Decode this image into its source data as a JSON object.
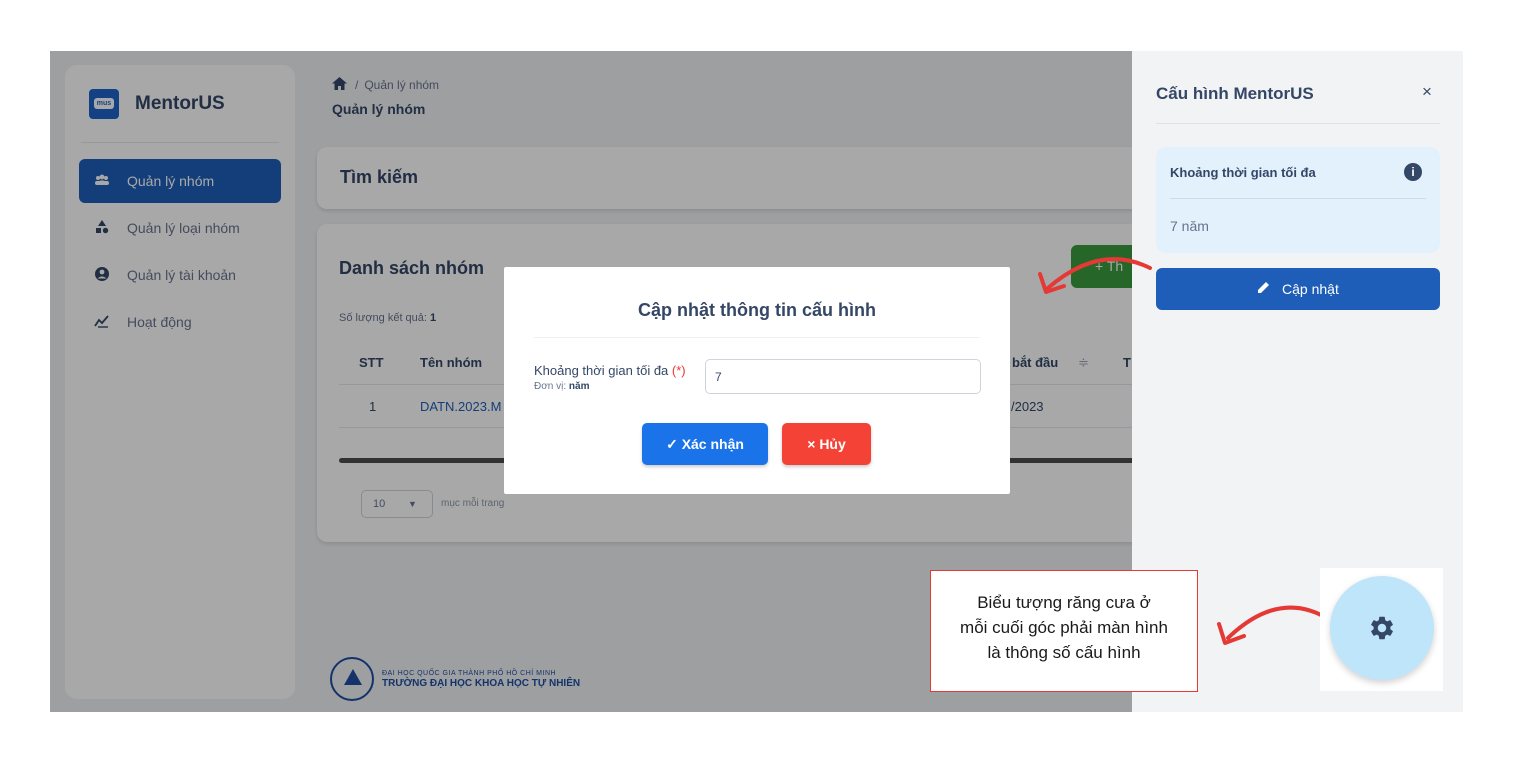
{
  "app": {
    "name": "MentorUS",
    "logo_text": "mus"
  },
  "sidebar": {
    "items": [
      {
        "label": "Quản lý nhóm",
        "icon": "users-icon",
        "active": true
      },
      {
        "label": "Quản lý loại nhóm",
        "icon": "shapes-icon",
        "active": false
      },
      {
        "label": "Quản lý tài khoản",
        "icon": "user-circle-icon",
        "active": false
      },
      {
        "label": "Hoạt động",
        "icon": "activity-chart-icon",
        "active": false
      }
    ]
  },
  "header": {
    "breadcrumb": "Quản lý nhóm",
    "title": "Quản lý nhóm"
  },
  "search": {
    "title": "Tìm kiếm"
  },
  "group_list": {
    "title": "Danh sách nhóm",
    "add_label": "+ Th",
    "result_label": "Số lượng kết quả:",
    "result_count": "1",
    "columns": {
      "stt": "STT",
      "name": "Tên nhóm",
      "start": "bắt đầu",
      "sort_icon": "≑",
      "next": "T"
    },
    "rows": [
      {
        "stt": "1",
        "name": "DATN.2023.M",
        "start": "/2023"
      }
    ],
    "page_size": "10",
    "per_page_label": "mục mỗi trang"
  },
  "footer": {
    "university_line1": "ĐẠI HỌC QUỐC GIA THÀNH PHỐ HỒ CHÍ MINH",
    "university_line2": "TRƯỜNG ĐẠI HỌC KHOA HỌC TỰ NHIÊN"
  },
  "config_panel": {
    "title": "Cấu hình MentorUS",
    "close": "×",
    "field_label": "Khoảng thời gian tối đa",
    "info_icon": "i",
    "field_value": "7 năm",
    "update_label": "Cập nhật"
  },
  "modal": {
    "title": "Cập nhật thông tin cấu hình",
    "field_label": "Khoảng thời gian tối đa",
    "required_mark": "(*)",
    "unit_label": "Đơn vị:",
    "unit_value": "năm",
    "input_value": "7",
    "confirm_label": "Xác nhận",
    "cancel_label": "Hủy"
  },
  "annotation": {
    "text_line1": "Biểu tượng răng cưa ở",
    "text_line2": "mỗi cuối góc phải màn hình",
    "text_line3": "là thông số cấu hình"
  },
  "colors": {
    "primary": "#1f5eb8",
    "confirm": "#1a73e8",
    "cancel": "#f44336",
    "add": "#3a9b3e",
    "annotation_arrow": "#e53935",
    "config_fab": "#bfe5fb"
  }
}
